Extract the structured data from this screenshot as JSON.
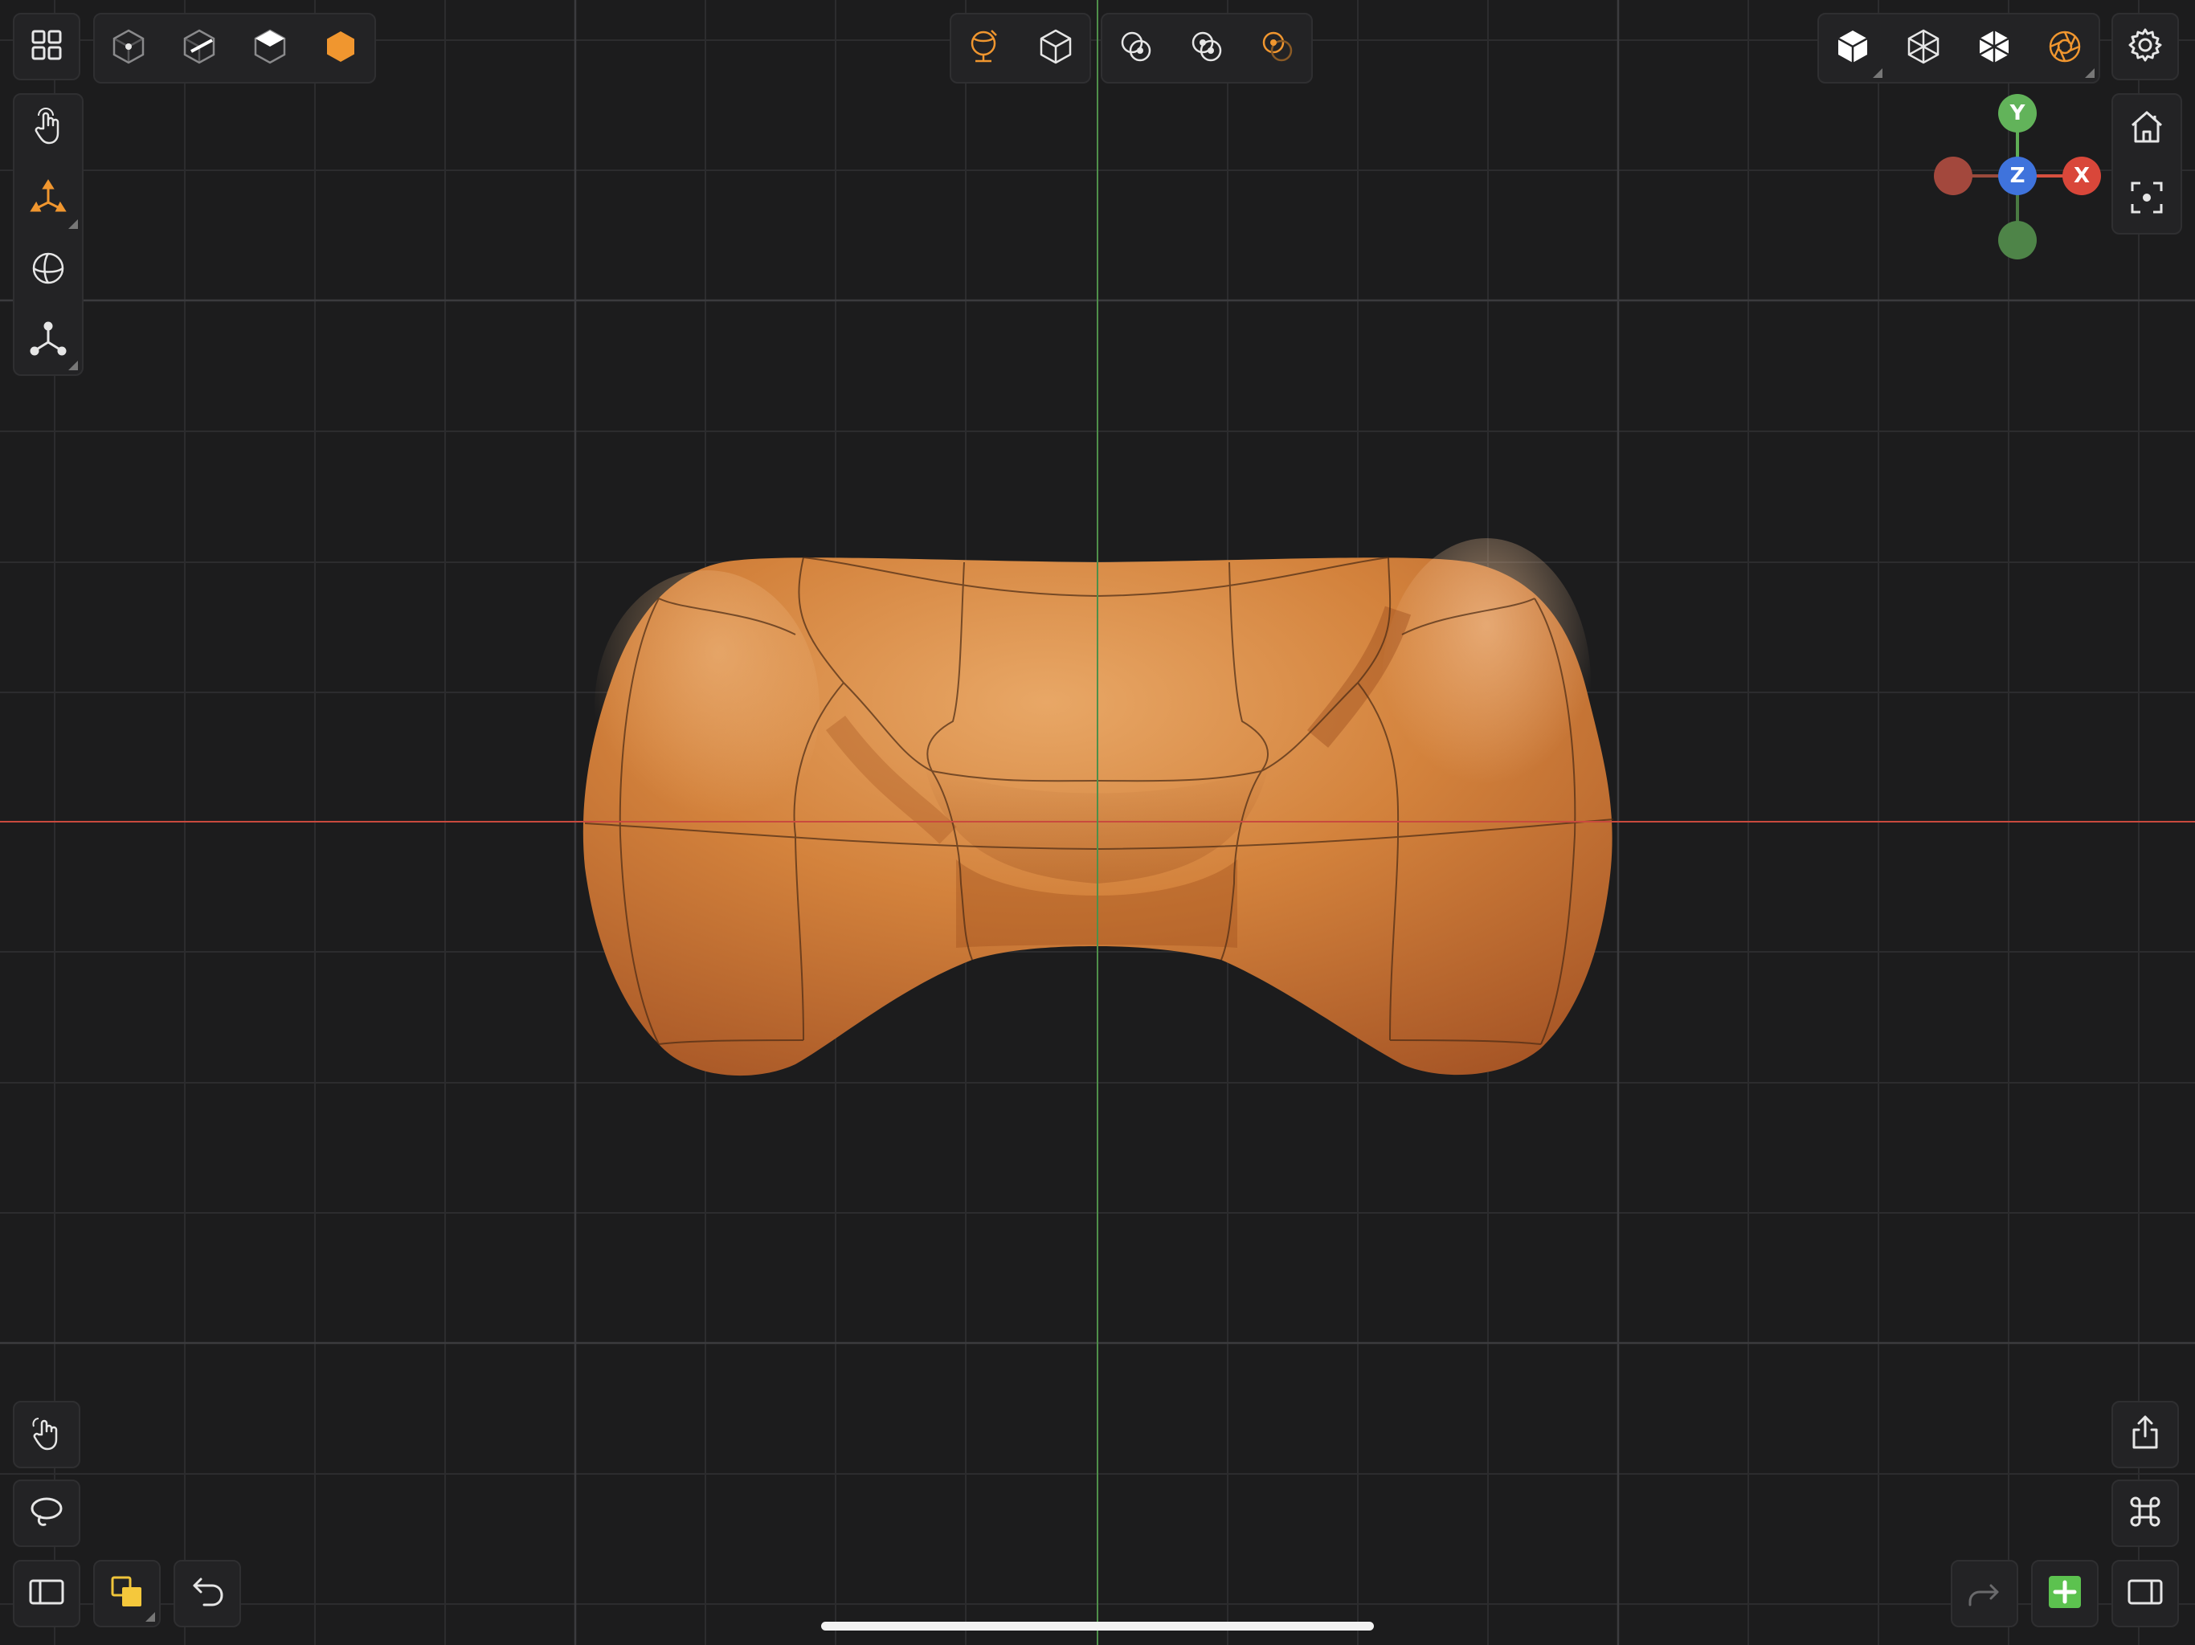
{
  "app": {
    "accent_color": "#f0962f",
    "model_color": "#d98238",
    "grid_color": "#2e2e30",
    "x_axis_color": "#c94a3e",
    "y_axis_color": "#4f8f4a"
  },
  "top_left": {
    "menu_icon": "grid-menu-icon",
    "selection_modes": [
      "vertex-mode-icon",
      "edge-mode-icon",
      "face-mode-icon",
      "object-mode-icon"
    ],
    "active_selection_mode": "object-mode-icon"
  },
  "left_tools": [
    "hand-tool-icon",
    "transform-gizmo-icon",
    "sphere-tool-icon",
    "pivot-tool-icon"
  ],
  "active_left_tool": "transform-gizmo-icon",
  "top_center": {
    "group1": [
      "global-space-icon",
      "local-space-icon"
    ],
    "group2": [
      "snap-icon",
      "proportional-icon",
      "soft-selection-icon"
    ]
  },
  "top_right": {
    "display_modes": [
      "solid-cube-icon",
      "wireframe-cube-icon",
      "xray-cube-icon",
      "render-aperture-icon"
    ],
    "active_display_mode": "render-aperture-icon",
    "settings_icon": "gear-icon"
  },
  "nav_gizmo": {
    "y_label": "Y",
    "z_label": "Z",
    "x_label": "X"
  },
  "right_tools": [
    "home-icon",
    "focus-icon"
  ],
  "bottom_left": [
    "touch-gesture-icon",
    "lasso-icon",
    "sidebar-left-icon",
    "layers-icon",
    "undo-icon"
  ],
  "bottom_right": [
    "share-icon",
    "command-icon",
    "redo-icon",
    "add-icon",
    "sidebar-right-icon"
  ]
}
